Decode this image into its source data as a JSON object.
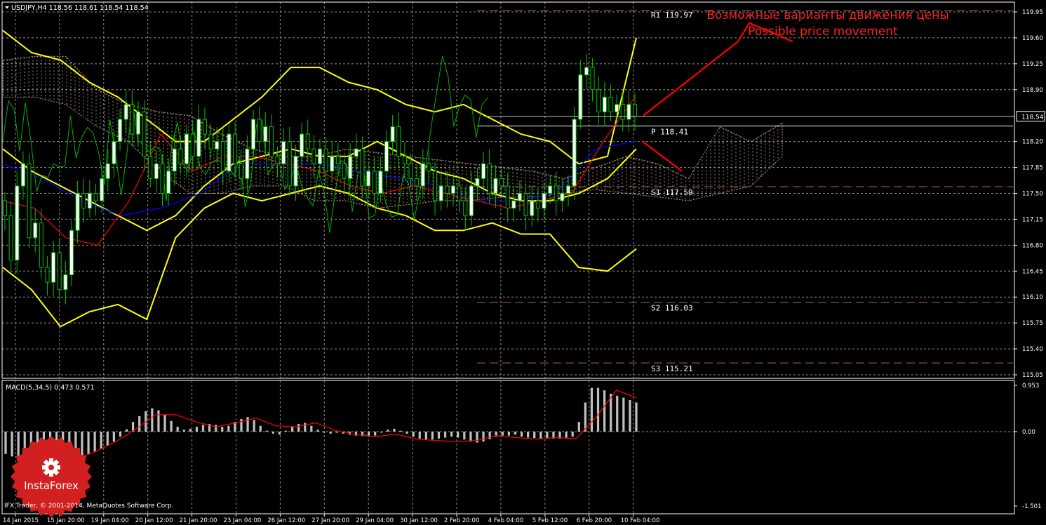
{
  "header": {
    "symbol_info": "USDJPY,H4  118.56 118.61 118.54 118.54",
    "indicator_info": "MACD(5,34,5) 0.473 0.571"
  },
  "annotation": {
    "line_ru": "Возможные варианты движения цены",
    "line_en": "Possible price movement"
  },
  "branding": {
    "logo_text": "InstaForex",
    "copyright": "IFX Trader, © 2001-2014, MetaQuotes Software Corp."
  },
  "colors": {
    "background": "#000000",
    "grid": "#8c8c8c",
    "candle_bull": "#ffffff",
    "candle_bear": "#000000",
    "candle_outline": "#00c000",
    "bollinger": "#ffff00",
    "tenkan": "#ff0000",
    "kijun": "#0000ff",
    "chikou": "#00b000",
    "kumo": "#d2b48c",
    "pivot_lines": "#b06060",
    "forecast": "#ff0000",
    "macd_hist": "#c0c0c0",
    "macd_signal": "#ff0000",
    "logo": "#d62020"
  },
  "chart_data": [
    {
      "type": "candlestick",
      "symbol": "USDJPY",
      "timeframe": "H4",
      "ylim": [
        115.05,
        119.95
      ],
      "y_ticks": [
        "119.95",
        "119.60",
        "119.25",
        "118.90",
        "118.20",
        "117.85",
        "117.50",
        "117.15",
        "116.80",
        "116.45",
        "116.10",
        "115.75",
        "115.40",
        "115.05"
      ],
      "current_price": "118.54",
      "x_ticks": [
        "14 Jan 2015",
        "15 Jan 20:00",
        "19 Jan 04:00",
        "20 Jan 12:00",
        "21 Jan 20:00",
        "23 Jan 04:00",
        "26 Jan 12:00",
        "27 Jan 20:00",
        "29 Jan 04:00",
        "30 Jan 12:00",
        "2 Feb 20:00",
        "4 Feb 04:00",
        "5 Feb 12:00",
        "6 Feb 20:00",
        "10 Feb 04:00"
      ],
      "levels": [
        {
          "label": "R1",
          "value": "119.97"
        },
        {
          "label": "P",
          "value": "118.41"
        },
        {
          "label": "S1",
          "value": "117.59"
        },
        {
          "label": "S2",
          "value": "116.03"
        },
        {
          "label": "S3",
          "value": "115.21"
        }
      ],
      "close_path": [
        117.2,
        116.6,
        117.6,
        117.9,
        116.9,
        117.1,
        116.5,
        116.3,
        116.7,
        116.2,
        116.4,
        117.0,
        117.5,
        117.3,
        117.5,
        117.4,
        117.7,
        117.9,
        118.2,
        118.5,
        118.7,
        118.3,
        118.6,
        118.0,
        117.7,
        117.9,
        117.5,
        117.8,
        118.1,
        117.9,
        118.3,
        118.0,
        118.5,
        118.3,
        118.1,
        118.2,
        117.8,
        118.3,
        117.9,
        117.7,
        118.1,
        118.5,
        118.2,
        118.4,
        118.0,
        117.9,
        118.2,
        117.6,
        118.0,
        118.3,
        118.1,
        117.9,
        118.1,
        117.8,
        118.0,
        117.9,
        117.7,
        118.0,
        118.1,
        117.6,
        117.8,
        117.5,
        117.8,
        118.2,
        118.4,
        118.0,
        117.9,
        117.7,
        117.6,
        117.9,
        117.8,
        117.4,
        117.6,
        117.5,
        117.6,
        117.4,
        117.2,
        117.6,
        117.7,
        117.9,
        117.5,
        117.7,
        117.6,
        117.3,
        117.4,
        117.5,
        117.2,
        117.4,
        117.3,
        117.5,
        117.6,
        117.4,
        117.5,
        117.6,
        118.5,
        119.1,
        119.2,
        118.9,
        118.6,
        118.8,
        118.6,
        118.7,
        118.5,
        118.7,
        118.54
      ],
      "bollinger_upper": [
        119.7,
        119.4,
        119.3,
        119.0,
        118.8,
        118.5,
        118.2,
        118.2,
        118.5,
        118.8,
        119.2,
        119.2,
        119.0,
        118.9,
        118.7,
        118.6,
        118.7,
        118.5,
        118.3,
        118.2,
        117.9,
        118.0,
        119.6
      ],
      "bollinger_middle": [
        118.1,
        117.8,
        117.6,
        117.4,
        117.2,
        117.0,
        117.2,
        117.6,
        117.9,
        118.0,
        118.1,
        118.0,
        118.0,
        118.2,
        118.0,
        117.8,
        117.7,
        117.5,
        117.4,
        117.4,
        117.5,
        117.7,
        118.1
      ],
      "bollinger_lower": [
        116.5,
        116.2,
        115.7,
        115.9,
        116.0,
        115.8,
        116.9,
        117.3,
        117.5,
        117.4,
        117.5,
        117.6,
        117.5,
        117.3,
        117.2,
        117.0,
        117.0,
        117.1,
        116.95,
        116.95,
        116.5,
        116.45,
        116.75
      ],
      "tenkan": [
        117.4,
        117.3,
        116.9,
        116.8,
        117.4,
        118.3,
        117.8,
        118.0,
        118.0,
        117.9,
        117.8,
        117.6,
        117.5,
        117.6,
        117.5,
        117.4,
        117.3,
        117.4,
        117.5,
        118.2,
        118.8
      ],
      "kijun": [
        117.9,
        117.7,
        117.4,
        117.2,
        117.3,
        117.5,
        117.9,
        117.9,
        117.9,
        117.8,
        117.7,
        117.6,
        117.4,
        117.4,
        117.5,
        118.1,
        118.2
      ],
      "forecast_paths": [
        [
          [
            118.55,
            119.55
          ],
          [
            119.8,
            119.55
          ]
        ],
        [
          [
            118.2,
            117.8
          ]
        ]
      ]
    },
    {
      "type": "bar",
      "name": "MACD",
      "ylim": [
        -1.501,
        0.953
      ],
      "y_ticks": [
        "0.953",
        "0.00",
        "-1.501"
      ],
      "histogram": [
        -0.45,
        -0.5,
        -0.5,
        -0.48,
        -0.46,
        -0.5,
        -0.52,
        -0.55,
        -0.55,
        -0.56,
        -0.54,
        -0.52,
        -0.5,
        -0.46,
        -0.4,
        -0.34,
        -0.28,
        -0.2,
        -0.1,
        0.05,
        0.2,
        0.32,
        0.42,
        0.48,
        0.44,
        0.35,
        0.22,
        0.1,
        0.04,
        0.06,
        0.1,
        0.14,
        0.16,
        0.14,
        0.1,
        0.12,
        0.2,
        0.26,
        0.3,
        0.24,
        0.12,
        0.02,
        -0.04,
        -0.06,
        0.02,
        0.1,
        0.16,
        0.18,
        0.12,
        0.04,
        -0.02,
        -0.04,
        -0.02,
        -0.04,
        -0.06,
        -0.08,
        -0.09,
        -0.1,
        -0.08,
        -0.02,
        0.04,
        0.06,
        0.02,
        -0.04,
        -0.1,
        -0.14,
        -0.16,
        -0.16,
        -0.14,
        -0.12,
        -0.1,
        -0.12,
        -0.16,
        -0.2,
        -0.22,
        -0.2,
        -0.15,
        -0.1,
        -0.08,
        -0.08,
        -0.06,
        -0.1,
        -0.12,
        -0.13,
        -0.14,
        -0.14,
        -0.14,
        -0.14,
        -0.12,
        -0.1,
        0.2,
        0.6,
        0.9,
        0.9,
        0.85,
        0.78,
        0.74,
        0.7,
        0.65,
        0.6
      ],
      "signal": [
        -0.55,
        -0.4,
        -0.2,
        0.05,
        0.35,
        0.35,
        0.2,
        0.1,
        0.18,
        0.28,
        0.12,
        0.1,
        0.18,
        0.02,
        -0.06,
        -0.1,
        -0.05,
        -0.15,
        -0.18,
        -0.2,
        -0.18,
        -0.08,
        -0.12,
        -0.15,
        -0.12,
        -0.14,
        0.3,
        0.85,
        0.7
      ]
    }
  ]
}
